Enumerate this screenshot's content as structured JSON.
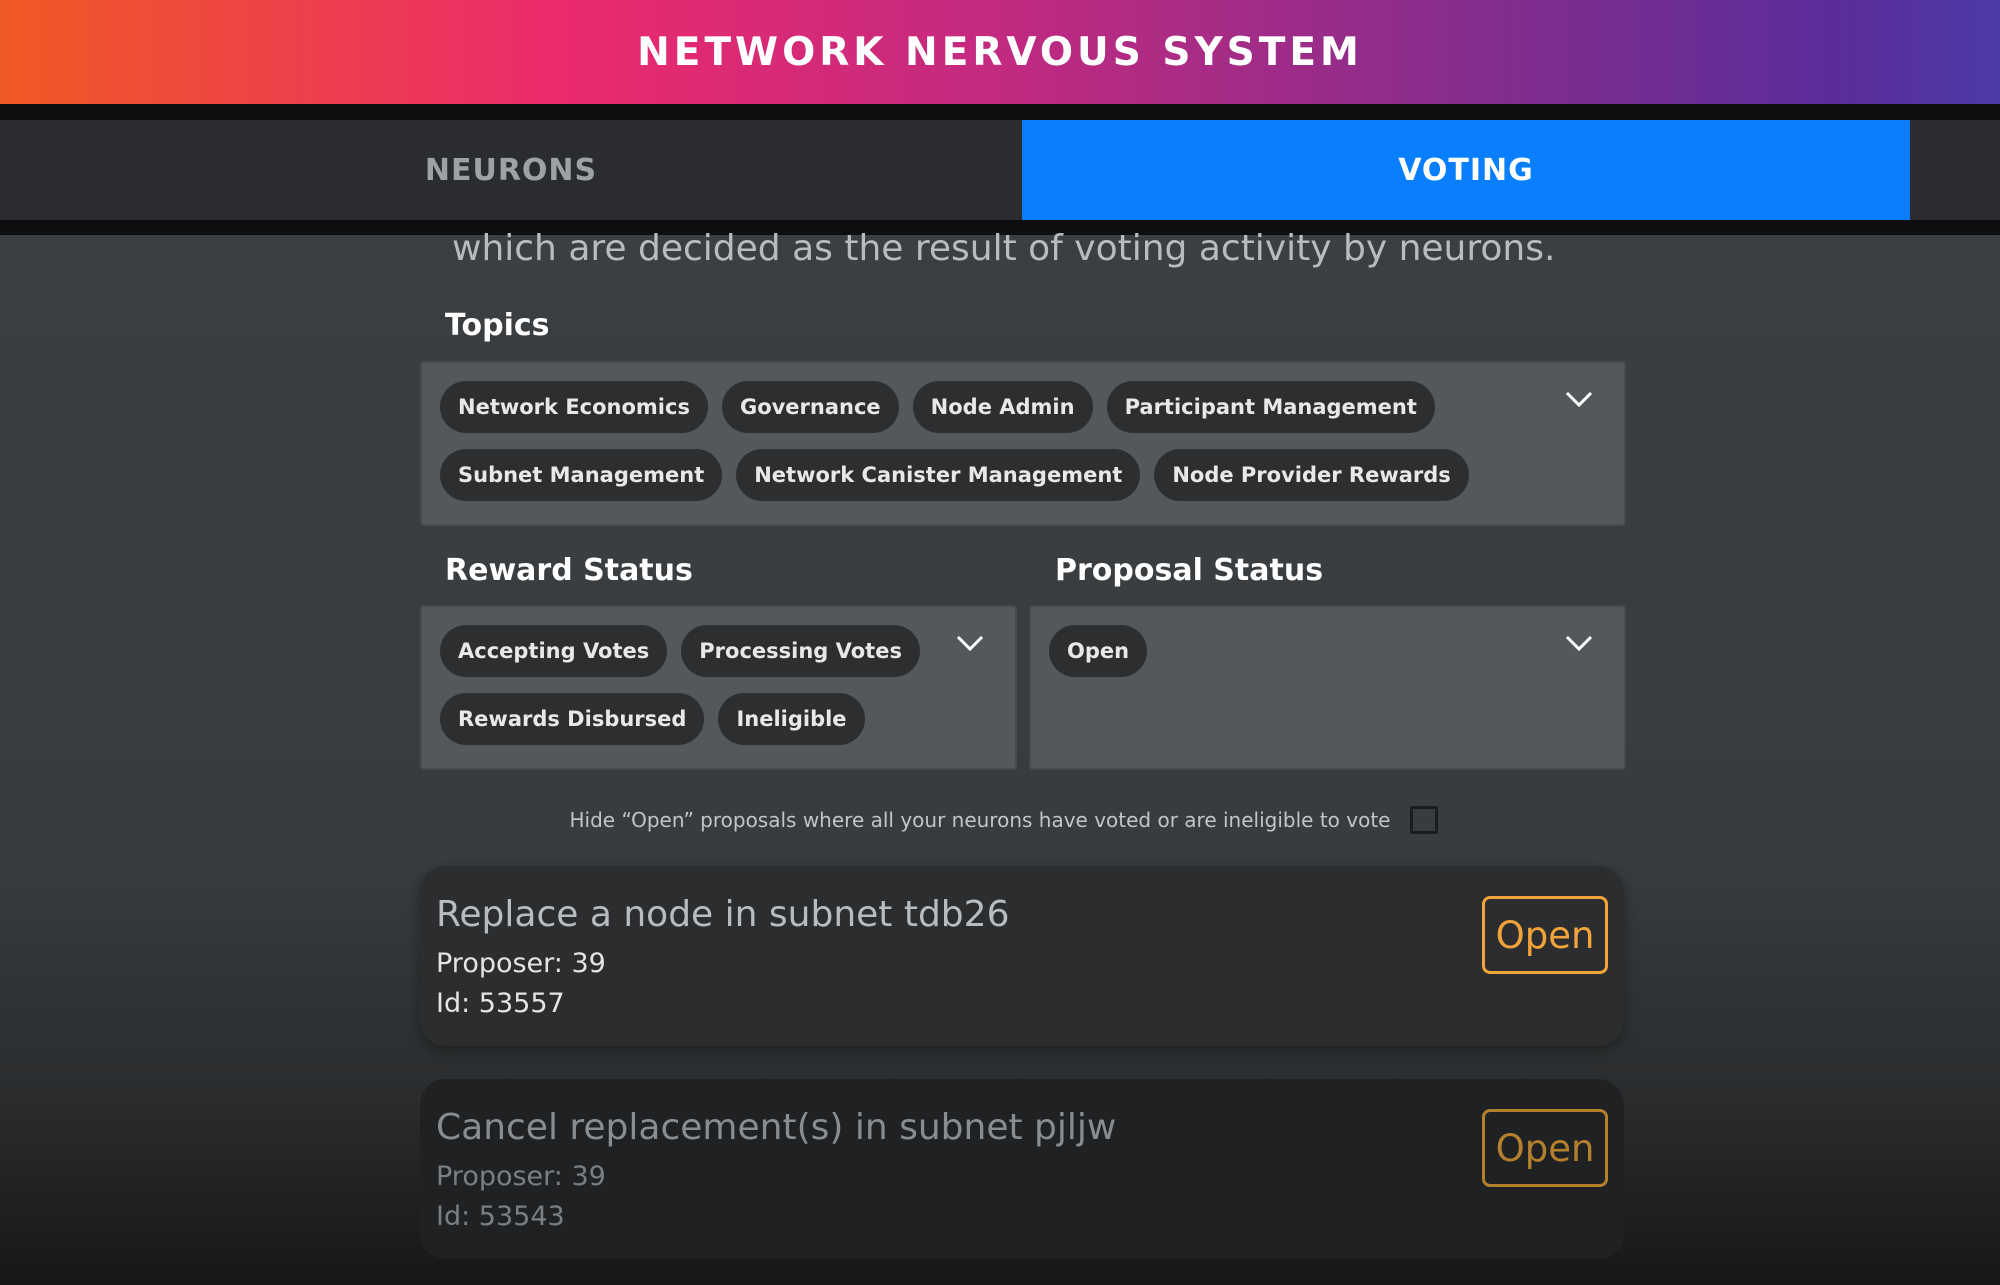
{
  "header": {
    "title": "NETWORK NERVOUS SYSTEM"
  },
  "tabs": [
    {
      "label": "NEURONS",
      "active": false
    },
    {
      "label": "VOTING",
      "active": true
    }
  ],
  "intro": "which are decided as the result of voting activity by neurons.",
  "topics": {
    "label": "Topics",
    "chips": [
      "Network Economics",
      "Governance",
      "Node Admin",
      "Participant Management",
      "Subnet Management",
      "Network Canister Management",
      "Node Provider Rewards"
    ]
  },
  "reward_status": {
    "label": "Reward Status",
    "chips": [
      "Accepting Votes",
      "Processing Votes",
      "Rewards Disbursed",
      "Ineligible"
    ]
  },
  "proposal_status": {
    "label": "Proposal Status",
    "chips": [
      "Open"
    ]
  },
  "hide_filter": {
    "label": "Hide “Open” proposals where all your neurons have voted or are ineligible to vote",
    "checked": false
  },
  "proposals": [
    {
      "title": "Replace a node in subnet tdb26",
      "proposer": "Proposer: 39",
      "id": "Id: 53557",
      "status": "Open"
    },
    {
      "title": "Cancel replacement(s) in subnet pjljw",
      "proposer": "Proposer: 39",
      "id": "Id: 53543",
      "status": "Open"
    }
  ],
  "colors": {
    "accent_blue": "#0a7ffe",
    "status_open": "#f2a43a",
    "chip_bg": "#2c2e30",
    "filter_bg": "#54585a"
  }
}
